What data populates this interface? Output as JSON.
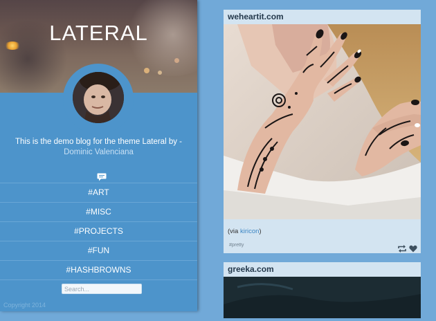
{
  "blog": {
    "title": "LATERAL",
    "description": "This is the demo blog for the theme Lateral by -",
    "author": "Dominic Valenciana",
    "copyright": "Copyright 2014"
  },
  "nav": {
    "items": [
      "#ART",
      "#MISC",
      "#PROJECTS",
      "#FUN",
      "#HASHBROWNS"
    ]
  },
  "search": {
    "placeholder": "Search..."
  },
  "icons": {
    "ask": "message-icon",
    "reblog": "reblog-icon",
    "like": "heart-icon"
  },
  "colors": {
    "sidebar": "#4d94cb",
    "background": "#71a9d8",
    "post_card": "#d3e4f1",
    "link": "#3c86c4"
  },
  "posts": [
    {
      "source": "weheartit.com",
      "caption_prefix": "(via ",
      "caption_link": "kiricon",
      "caption_suffix": ")",
      "tag": "#pretty"
    },
    {
      "source": "greeka.com"
    }
  ]
}
